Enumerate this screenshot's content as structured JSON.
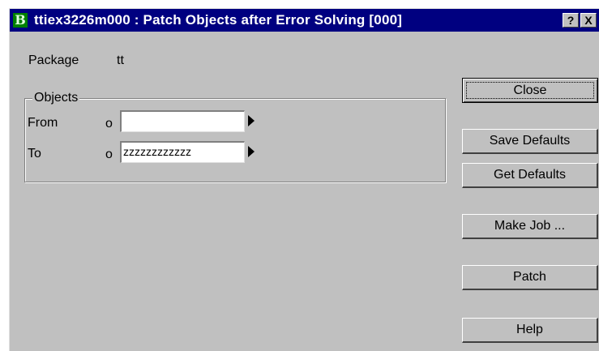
{
  "window": {
    "title": "ttiex3226m000 : Patch Objects after Error Solving [000]",
    "app_icon_letter": "B",
    "help_button": "?",
    "close_button": "X"
  },
  "form": {
    "package_label": "Package",
    "package_value": "tt",
    "objects_group_label": "Objects",
    "from_label": "From",
    "from_operator": "o",
    "from_value": "",
    "to_label": "To",
    "to_operator": "o",
    "to_value": "zzzzzzzzzzzz"
  },
  "buttons": {
    "close": "Close",
    "save_defaults": "Save Defaults",
    "get_defaults": "Get Defaults",
    "make_job": "Make Job ...",
    "patch": "Patch",
    "help": "Help"
  }
}
